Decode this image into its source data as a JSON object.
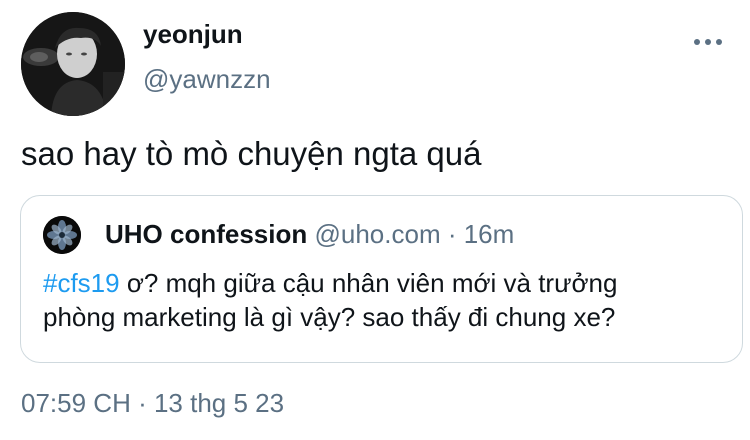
{
  "author": {
    "name": "yeonjun",
    "handle": "@yawnzzn",
    "avatar_icon": "profile-photo"
  },
  "menu": {
    "icon": "more-horizontal-icon"
  },
  "tweet": {
    "text": "sao hay tò mò chuyện ngta quá"
  },
  "quote": {
    "name": "UHO confession",
    "handle": "@uho.com",
    "separator": " · ",
    "time": "16m",
    "hashtag": "#cfs19",
    "text_line1": " ơ? mqh giữa cậu nhân viên mới và trưởng",
    "text_line2": "phòng marketing là gì vậy? sao thấy đi chung xe?"
  },
  "footer": {
    "timestamp": "07:59 CH · 13 thg 5 23"
  },
  "colors": {
    "text": "#0f1419",
    "secondary": "#5b7083",
    "link": "#1d9bf0",
    "border": "#cfd9de"
  }
}
